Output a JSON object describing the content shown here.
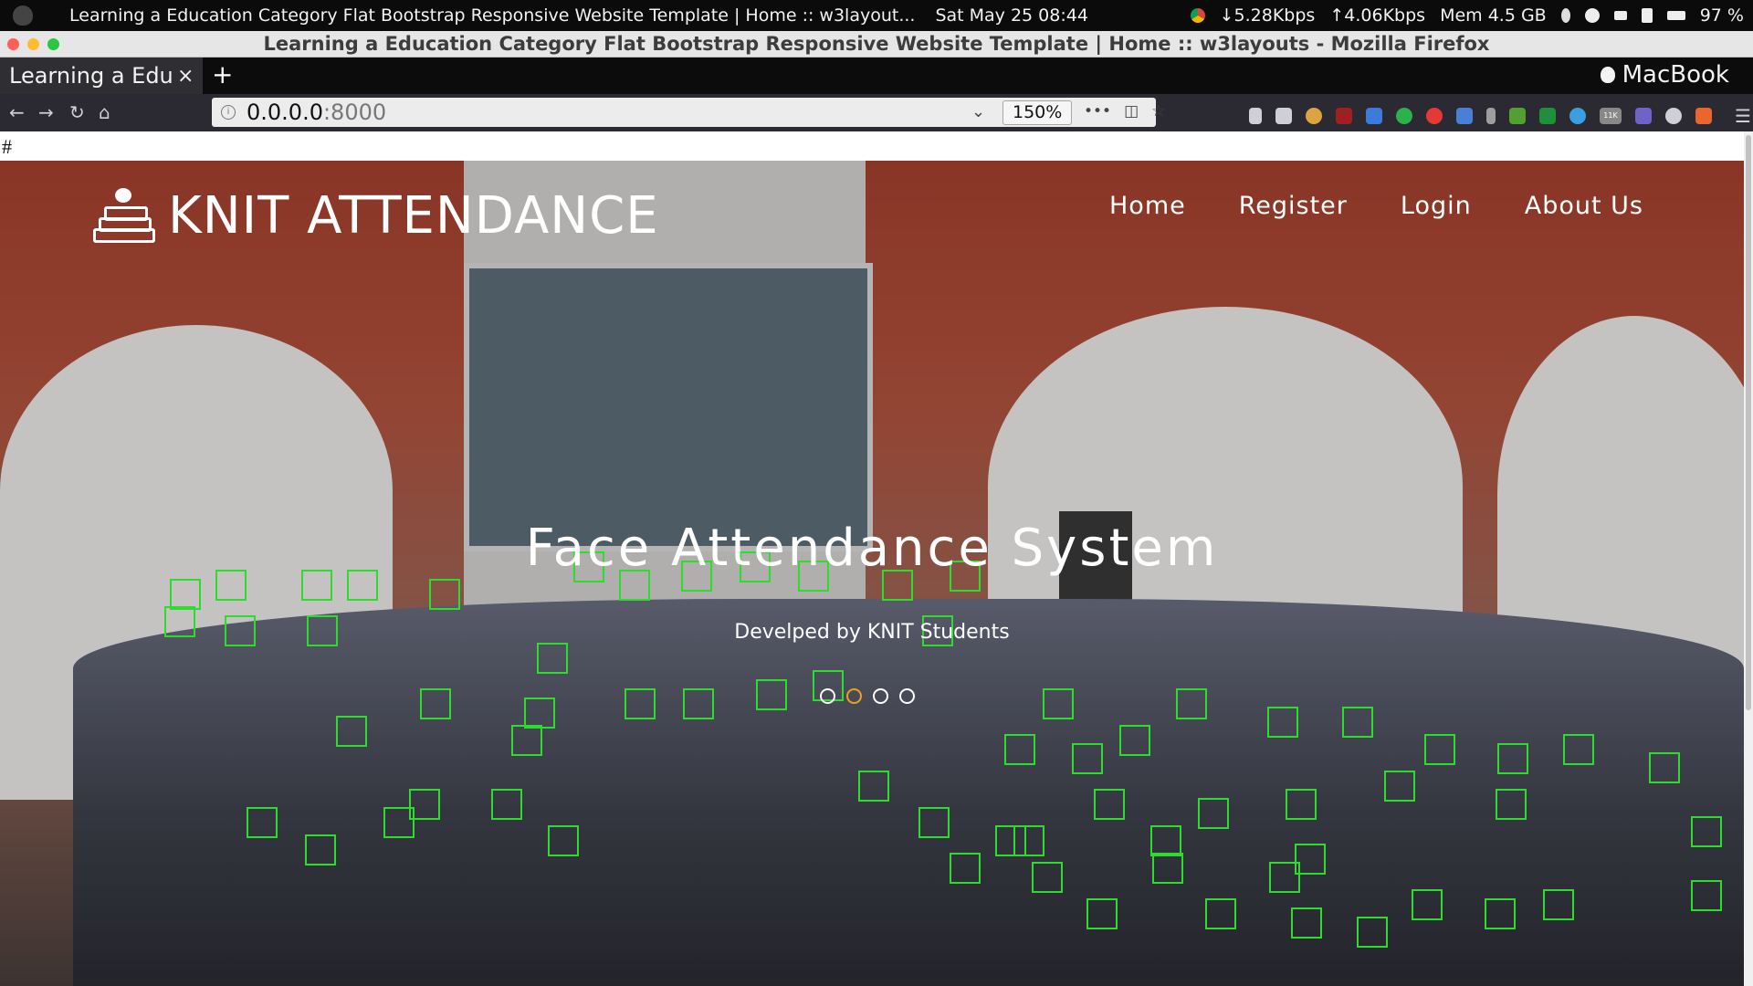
{
  "os_bar": {
    "window_title": "Learning a Education Category Flat Bootstrap Responsive Website Template | Home :: w3layout...",
    "clock": "Sat May 25  08:44",
    "net_down": "↓5.28Kbps",
    "net_up": "↑4.06Kbps",
    "memory": "Mem 4.5 GB",
    "battery": "97 %"
  },
  "window": {
    "title": "Learning a Education Category Flat Bootstrap Responsive Website Template | Home :: w3layouts - Mozilla Firefox",
    "traffic_colors": [
      "#fe5f57",
      "#febc2e",
      "#28c840"
    ]
  },
  "tab_strip": {
    "tab_label": "Learning a Educa",
    "close": "×",
    "new_tab": "+",
    "brand": "MacBook"
  },
  "toolbar": {
    "back": "←",
    "forward": "→",
    "reload": "↻",
    "home": "⌂",
    "url_host": "0.0.0.0",
    "url_port": ":8000",
    "zoom": "150%",
    "more": "•••",
    "pocket": "◫",
    "bookmark": "☆",
    "menu": "☰",
    "ext_badge": "11K"
  },
  "page": {
    "hash": "#",
    "site_title": "KNIT ATTENDANCE",
    "nav": [
      "Home",
      "Register",
      "Login",
      "About Us"
    ],
    "hero_heading": "Face Attendance System",
    "hero_subtitle": "Develped by KNIT Students",
    "slider_active_index": 1
  }
}
